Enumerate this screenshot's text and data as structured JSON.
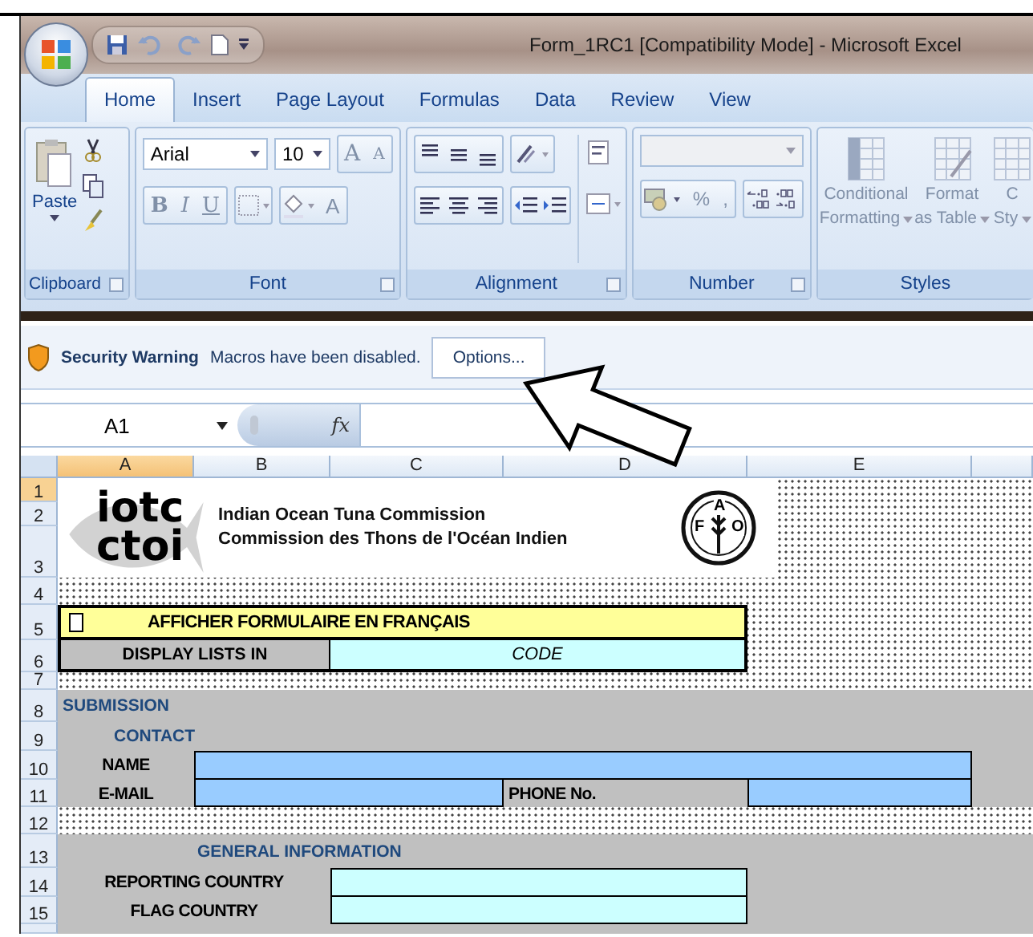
{
  "window": {
    "title": "Form_1RC1  [Compatibility Mode] - Microsoft Excel"
  },
  "tabs": [
    {
      "label": "Home",
      "selected": true
    },
    {
      "label": "Insert",
      "selected": false
    },
    {
      "label": "Page Layout",
      "selected": false
    },
    {
      "label": "Formulas",
      "selected": false
    },
    {
      "label": "Data",
      "selected": false
    },
    {
      "label": "Review",
      "selected": false
    },
    {
      "label": "View",
      "selected": false
    }
  ],
  "ribbon": {
    "clipboard": {
      "paste_label": "Paste",
      "group_label": "Clipboard"
    },
    "font": {
      "font_name": "Arial",
      "font_size": "10",
      "grow_label": "A",
      "shrink_label": "A",
      "bold_label": "B",
      "italic_label": "I",
      "underline_label": "U",
      "color_label": "A",
      "group_label": "Font"
    },
    "alignment": {
      "group_label": "Alignment"
    },
    "number": {
      "percent_label": "%",
      "comma_label": ",",
      "group_label": "Number"
    },
    "styles": {
      "buttons": [
        {
          "lines": [
            "Conditional",
            "Formatting"
          ]
        },
        {
          "lines": [
            "Format",
            "as Table"
          ]
        },
        {
          "lines": [
            "C",
            "Sty"
          ]
        }
      ],
      "group_label": "Styles"
    }
  },
  "security_bar": {
    "title": "Security Warning",
    "message": "Macros have been disabled.",
    "button": "Options..."
  },
  "formula_bar": {
    "name_box": "A1",
    "function_label": "fx"
  },
  "sheet": {
    "columns": [
      {
        "label": "A",
        "selected": true
      },
      {
        "label": "B",
        "selected": false
      },
      {
        "label": "C",
        "selected": false
      },
      {
        "label": "D",
        "selected": false
      },
      {
        "label": "E",
        "selected": false
      }
    ],
    "rows": [
      {
        "label": "1",
        "selected": true
      },
      {
        "label": "2",
        "selected": false
      },
      {
        "label": "3",
        "selected": false
      },
      {
        "label": "4",
        "selected": false
      },
      {
        "label": "5",
        "selected": false
      },
      {
        "label": "6",
        "selected": false
      },
      {
        "label": "7",
        "selected": false
      },
      {
        "label": "8",
        "selected": false
      },
      {
        "label": "9",
        "selected": false
      },
      {
        "label": "10",
        "selected": false
      },
      {
        "label": "11",
        "selected": false
      },
      {
        "label": "12",
        "selected": false
      },
      {
        "label": "13",
        "selected": false
      },
      {
        "label": "14",
        "selected": false
      },
      {
        "label": "15",
        "selected": false
      }
    ]
  },
  "header": {
    "line_1": "iotc",
    "line_2": "ctoi",
    "name_en": "Indian Ocean Tuna Commission",
    "name_fr": "Commission des Thons de l'Océan Indien",
    "fao_letters": [
      "F",
      "A",
      "O"
    ]
  },
  "language_toggle": {
    "checked": false,
    "label": "AFFICHER FORMULAIRE EN FRANÇAIS"
  },
  "display_lists": {
    "label": "DISPLAY LISTS IN",
    "value": "CODE"
  },
  "submission": {
    "title": "SUBMISSION",
    "contact_title": "CONTACT",
    "name_label": "NAME",
    "email_label": "E-MAIL",
    "phone_label": "PHONE No."
  },
  "general_information": {
    "title": "GENERAL INFORMATION",
    "reporting_country_label": "REPORTING COUNTRY",
    "flag_country_label": "FLAG COUNTRY"
  }
}
